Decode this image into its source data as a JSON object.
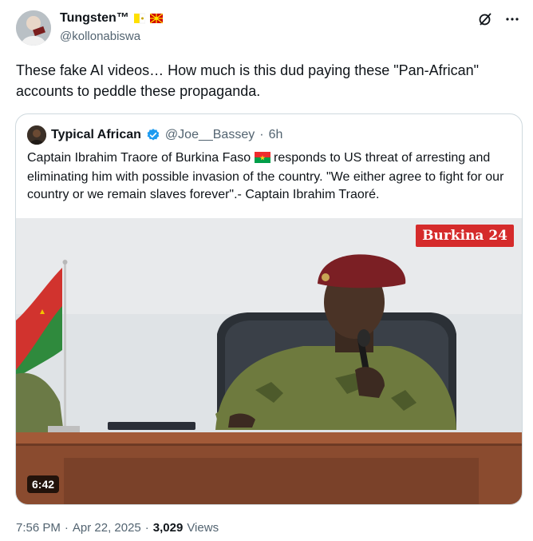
{
  "author": {
    "name": "Tungsten™",
    "handle": "@kollonabiswa",
    "flags": [
      "vatican-flag",
      "north-macedonia-flag"
    ]
  },
  "tweet": {
    "text": "These fake AI videos… How much is this dud paying these \"Pan-African\" accounts to peddle these propaganda."
  },
  "quote": {
    "name": "Typical African",
    "handle": "@Joe__Bassey",
    "separator": "·",
    "time": "6h",
    "text_before_flag": "Captain Ibrahim Traore of Burkina Faso",
    "text_after_flag": "responds to US threat of arresting and eliminating him with possible invasion of the country. \"We either agree to fight for our country or we remain slaves forever\".- Captain Ibrahim Traoré.",
    "video": {
      "duration": "6:42",
      "watermark": "Burkina 24"
    }
  },
  "footer": {
    "time": "7:56 PM",
    "dot1": "·",
    "date": "Apr 22, 2025",
    "dot2": "·",
    "views_count": "3,029",
    "views_label": "Views"
  },
  "colors": {
    "text": "#0f1419",
    "muted": "#536471",
    "border": "#cfd9de",
    "verified": "#1d9bf0",
    "watermark_bg": "#d52b2b"
  }
}
